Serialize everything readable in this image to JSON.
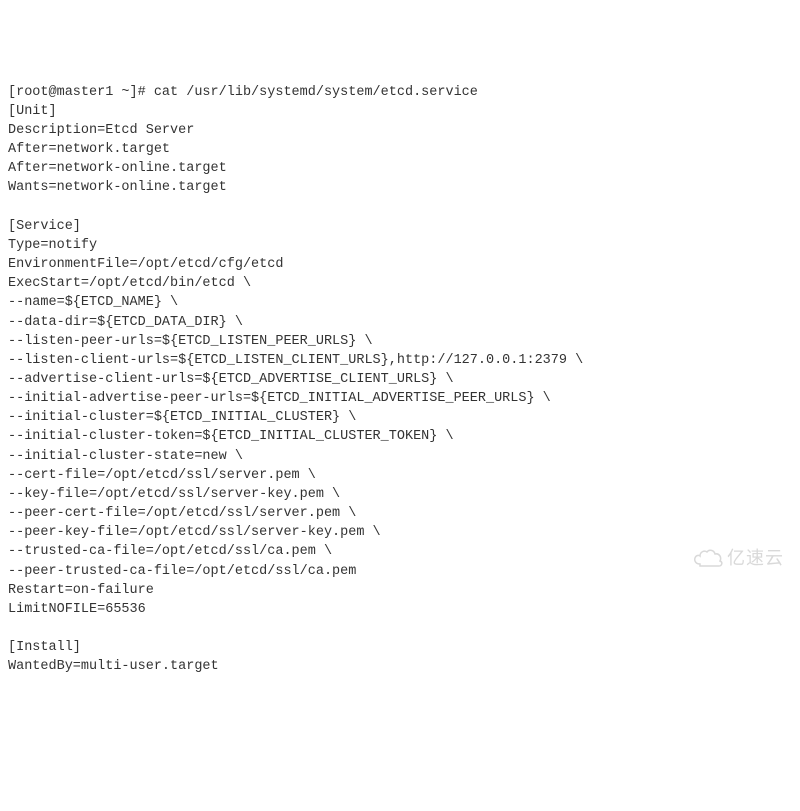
{
  "lines": [
    "[root@master1 ~]# cat /usr/lib/systemd/system/etcd.service",
    "[Unit]",
    "Description=Etcd Server",
    "After=network.target",
    "After=network-online.target",
    "Wants=network-online.target",
    "",
    "[Service]",
    "Type=notify",
    "EnvironmentFile=/opt/etcd/cfg/etcd",
    "ExecStart=/opt/etcd/bin/etcd \\",
    "--name=${ETCD_NAME} \\",
    "--data-dir=${ETCD_DATA_DIR} \\",
    "--listen-peer-urls=${ETCD_LISTEN_PEER_URLS} \\",
    "--listen-client-urls=${ETCD_LISTEN_CLIENT_URLS},http://127.0.0.1:2379 \\",
    "--advertise-client-urls=${ETCD_ADVERTISE_CLIENT_URLS} \\",
    "--initial-advertise-peer-urls=${ETCD_INITIAL_ADVERTISE_PEER_URLS} \\",
    "--initial-cluster=${ETCD_INITIAL_CLUSTER} \\",
    "--initial-cluster-token=${ETCD_INITIAL_CLUSTER_TOKEN} \\",
    "--initial-cluster-state=new \\",
    "--cert-file=/opt/etcd/ssl/server.pem \\",
    "--key-file=/opt/etcd/ssl/server-key.pem \\",
    "--peer-cert-file=/opt/etcd/ssl/server.pem \\",
    "--peer-key-file=/opt/etcd/ssl/server-key.pem \\",
    "--trusted-ca-file=/opt/etcd/ssl/ca.pem \\",
    "--peer-trusted-ca-file=/opt/etcd/ssl/ca.pem",
    "Restart=on-failure",
    "LimitNOFILE=65536",
    "",
    "[Install]",
    "WantedBy=multi-user.target"
  ],
  "watermark": "亿速云"
}
